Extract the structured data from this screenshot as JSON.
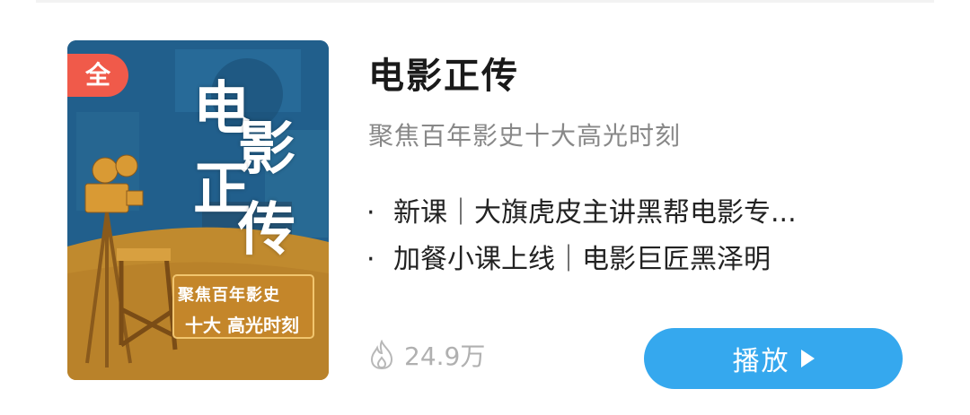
{
  "course": {
    "badge": "全",
    "cover_title_chars": [
      "电",
      "影",
      "正",
      "传"
    ],
    "cover_subtitle_line1": "聚焦百年影史",
    "cover_subtitle_line2": "十大 高光时刻",
    "title": "电影正传",
    "subtitle": "聚焦百年影史十大高光时刻",
    "bullets": [
      {
        "dot": "·",
        "text": "新课｜大旗虎皮主讲黑帮电影专..."
      },
      {
        "dot": "·",
        "text": "加餐小课上线｜电影巨匠黑泽明"
      }
    ],
    "views": "24.9万",
    "views_icon": "flame-icon",
    "play_label": "播放",
    "play_icon": "play-icon"
  },
  "colors": {
    "badge": "#f05a4a",
    "play_button": "#35a8ee",
    "cover_blue": "#1f5a86",
    "cover_gold": "#c48d2e"
  }
}
